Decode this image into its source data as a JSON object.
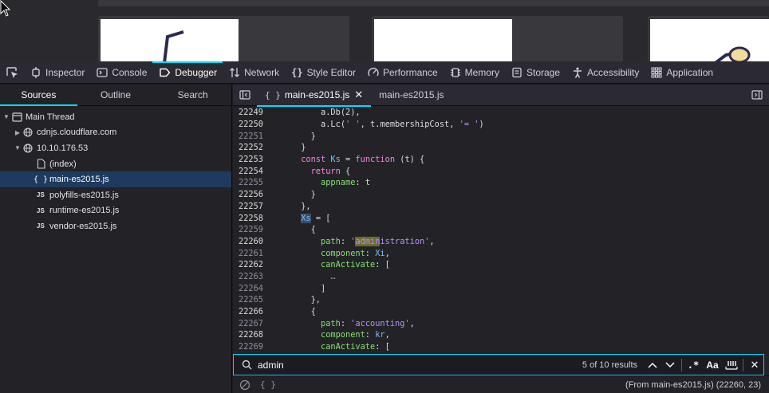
{
  "toolbar": {
    "tabs": [
      {
        "label": "Inspector",
        "icon": "inspector-icon"
      },
      {
        "label": "Console",
        "icon": "console-icon"
      },
      {
        "label": "Debugger",
        "icon": "debugger-icon",
        "active": true
      },
      {
        "label": "Network",
        "icon": "network-icon"
      },
      {
        "label": "Style Editor",
        "icon": "style-editor-icon"
      },
      {
        "label": "Performance",
        "icon": "performance-icon"
      },
      {
        "label": "Memory",
        "icon": "memory-icon"
      },
      {
        "label": "Storage",
        "icon": "storage-icon"
      },
      {
        "label": "Accessibility",
        "icon": "accessibility-icon"
      },
      {
        "label": "Application",
        "icon": "application-icon"
      }
    ]
  },
  "left_panel": {
    "tabs": [
      "Sources",
      "Outline",
      "Search"
    ],
    "tree": [
      {
        "label": "Main Thread",
        "icon": "window-icon"
      },
      {
        "label": "cdnjs.cloudflare.com",
        "icon": "globe-icon"
      },
      {
        "label": "10.10.176.53",
        "icon": "globe-icon"
      },
      {
        "label": "(index)",
        "icon": "file-icon"
      },
      {
        "label": "main-es2015.js",
        "icon": "braces-icon"
      },
      {
        "label": "polyfills-es2015.js",
        "icon": "js-icon",
        "badge": "JS"
      },
      {
        "label": "runtime-es2015.js",
        "icon": "js-icon",
        "badge": "JS"
      },
      {
        "label": "vendor-es2015.js",
        "icon": "js-icon",
        "badge": "JS"
      }
    ]
  },
  "editor": {
    "tabs": [
      {
        "label": "main-es2015.js",
        "brace": "{ }"
      },
      {
        "label": "main-es2015.js"
      }
    ],
    "lines": [
      {
        "n": "22249",
        "code": "          a.Db(2),"
      },
      {
        "n": "22250",
        "code": "          a.Lc(' ', t.membershipCost, '= ')"
      },
      {
        "n": "22251",
        "code": "        }"
      },
      {
        "n": "22252",
        "code": "      }"
      },
      {
        "n": "22253",
        "code": "      const Ks = function (t) {"
      },
      {
        "n": "22254",
        "code": "        return {"
      },
      {
        "n": "22255",
        "code": "          appname: t"
      },
      {
        "n": "22256",
        "code": "        }"
      },
      {
        "n": "22257",
        "code": "      },"
      },
      {
        "n": "22258",
        "code": "      Xs = ["
      },
      {
        "n": "22259",
        "code": "        {"
      },
      {
        "n": "22260",
        "code": "          path: 'administration',"
      },
      {
        "n": "22261",
        "code": "          component: Xi,"
      },
      {
        "n": "22262",
        "code": "          canActivate: ["
      },
      {
        "n": "22263",
        "code": "            …"
      },
      {
        "n": "22264",
        "code": "          ]"
      },
      {
        "n": "22265",
        "code": "        },"
      },
      {
        "n": "22266",
        "code": "        {"
      },
      {
        "n": "22267",
        "code": "          path: 'accounting',"
      },
      {
        "n": "22268",
        "code": "          component: kr,"
      },
      {
        "n": "22269",
        "code": "          canActivate: ["
      }
    ]
  },
  "search": {
    "value": "admin",
    "count": "5 of 10 results",
    "regex_label": ".*",
    "case_label": "Aa"
  },
  "status": {
    "brace": "{ }",
    "position": "(From main-es2015.js)  (22260, 23)"
  }
}
